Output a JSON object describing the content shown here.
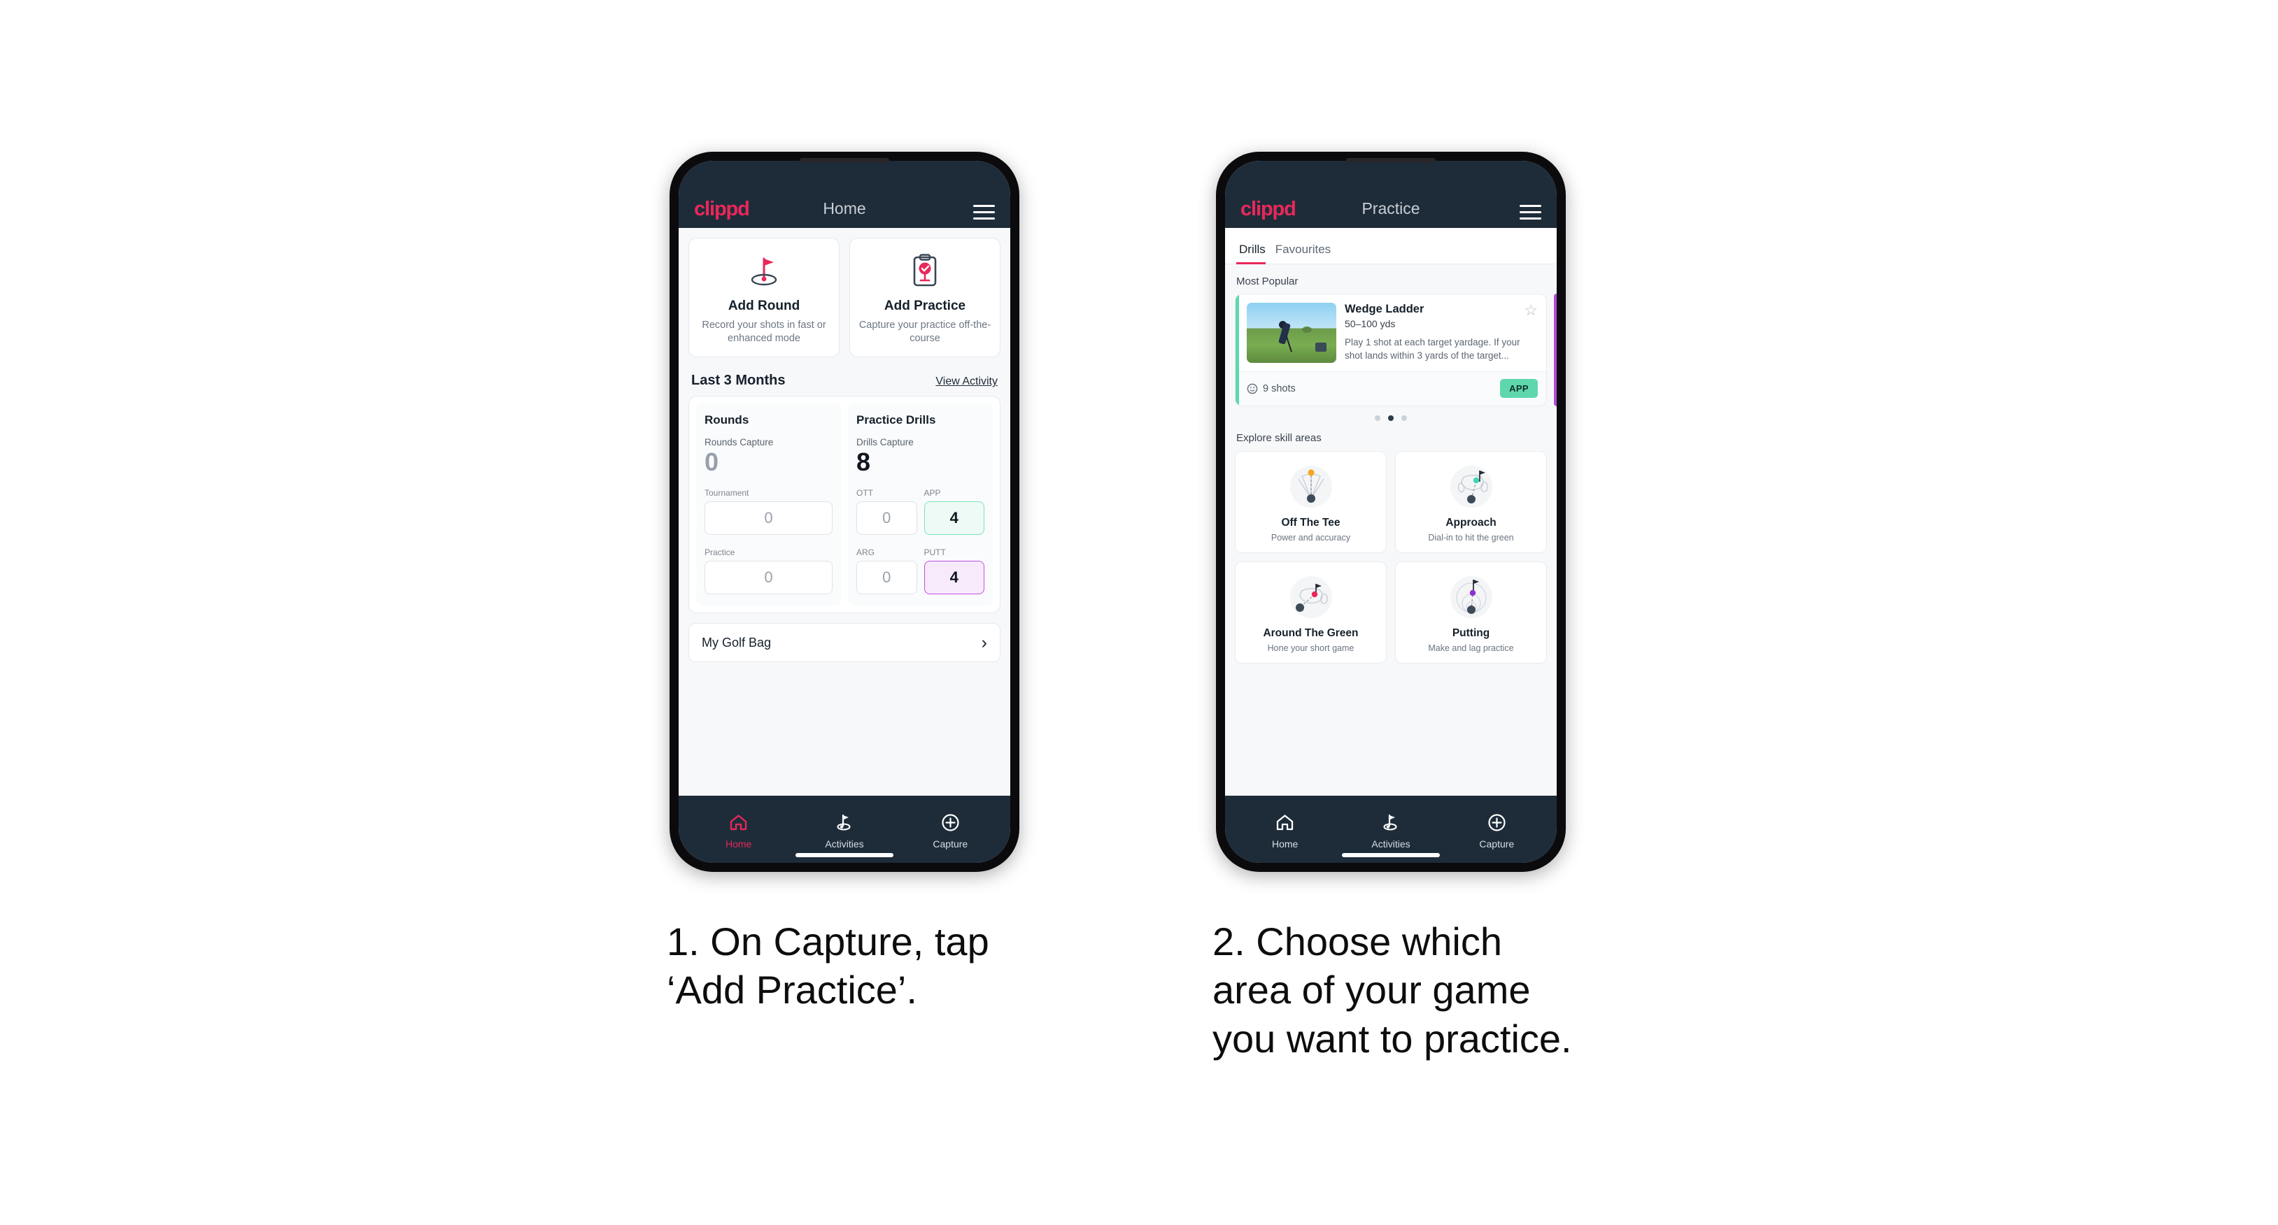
{
  "phone1": {
    "appbar": {
      "brand": "clippd",
      "title": "Home",
      "menu_icon": "hamburger-icon"
    },
    "quick_actions": [
      {
        "icon": "golf-flag-hole-icon",
        "title": "Add Round",
        "subtitle": "Record your shots in fast or enhanced mode"
      },
      {
        "icon": "clipboard-check-tee-icon",
        "title": "Add Practice",
        "subtitle": "Capture your practice off-the-course"
      }
    ],
    "section": {
      "title": "Last 3 Months",
      "link": "View Activity"
    },
    "rounds": {
      "heading": "Rounds",
      "capture_label": "Rounds Capture",
      "capture_value": "0",
      "metrics": [
        {
          "label": "Tournament",
          "value": "0",
          "state": "empty"
        },
        {
          "label": "Practice",
          "value": "0",
          "state": "empty"
        }
      ]
    },
    "drills": {
      "heading": "Practice Drills",
      "capture_label": "Drills Capture",
      "capture_value": "8",
      "metrics": [
        {
          "label": "OTT",
          "value": "0",
          "state": "empty"
        },
        {
          "label": "APP",
          "value": "4",
          "state": "green"
        },
        {
          "label": "ARG",
          "value": "0",
          "state": "empty"
        },
        {
          "label": "PUTT",
          "value": "4",
          "state": "purple"
        }
      ]
    },
    "golf_bag": {
      "label": "My Golf Bag",
      "chevron": "chevron-right-icon"
    },
    "bottom_nav": [
      {
        "icon": "home-icon",
        "label": "Home",
        "active": true
      },
      {
        "icon": "golf-flag-icon",
        "label": "Activities",
        "active": false
      },
      {
        "icon": "plus-circle-icon",
        "label": "Capture",
        "active": false
      }
    ]
  },
  "phone2": {
    "appbar": {
      "brand": "clippd",
      "title": "Practice",
      "menu_icon": "hamburger-icon"
    },
    "tabs": [
      {
        "label": "Drills",
        "active": true
      },
      {
        "label": "Favourites",
        "active": false
      }
    ],
    "most_popular_label": "Most Popular",
    "drill_card": {
      "name": "Wedge Ladder",
      "yardage": "50–100 yds",
      "description": "Play 1 shot at each target yardage. If your shot lands within 3 yards of the target...",
      "shots": "9 shots",
      "shots_icon": "clock-icon",
      "badge": "APP",
      "favourite_icon": "star-outline-icon",
      "accent_color": "#5fd7ac",
      "thumbnail": "golfer-wedge-shot-photo"
    },
    "carousel_dots": {
      "count": 3,
      "active_index": 1
    },
    "explore_label": "Explore skill areas",
    "skill_areas": [
      {
        "icon": "off-the-tee-icon",
        "name": "Off The Tee",
        "subtitle": "Power and accuracy",
        "dot_color": "#f5a623"
      },
      {
        "icon": "approach-icon",
        "name": "Approach",
        "subtitle": "Dial-in to hit the green",
        "dot_color": "#3ed6b5"
      },
      {
        "icon": "around-the-green-icon",
        "name": "Around The Green",
        "subtitle": "Hone your short game",
        "dot_color": "#e8285a"
      },
      {
        "icon": "putting-icon",
        "name": "Putting",
        "subtitle": "Make and lag practice",
        "dot_color": "#8e2fd4"
      }
    ],
    "bottom_nav": [
      {
        "icon": "home-icon",
        "label": "Home",
        "active": false
      },
      {
        "icon": "golf-flag-icon",
        "label": "Activities",
        "active": false
      },
      {
        "icon": "plus-circle-icon",
        "label": "Capture",
        "active": false
      }
    ]
  },
  "captions": {
    "one": "1. On Capture, tap\n‘Add Practice’.",
    "two": "2. Choose which\narea of your game\nyou want to practice."
  },
  "colors": {
    "brand_pink": "#e8285a",
    "appbar_navy": "#1e2c39",
    "green_accent": "#5fd7ac",
    "purple_accent": "#b24ae0",
    "page_bg": "#ffffff"
  }
}
